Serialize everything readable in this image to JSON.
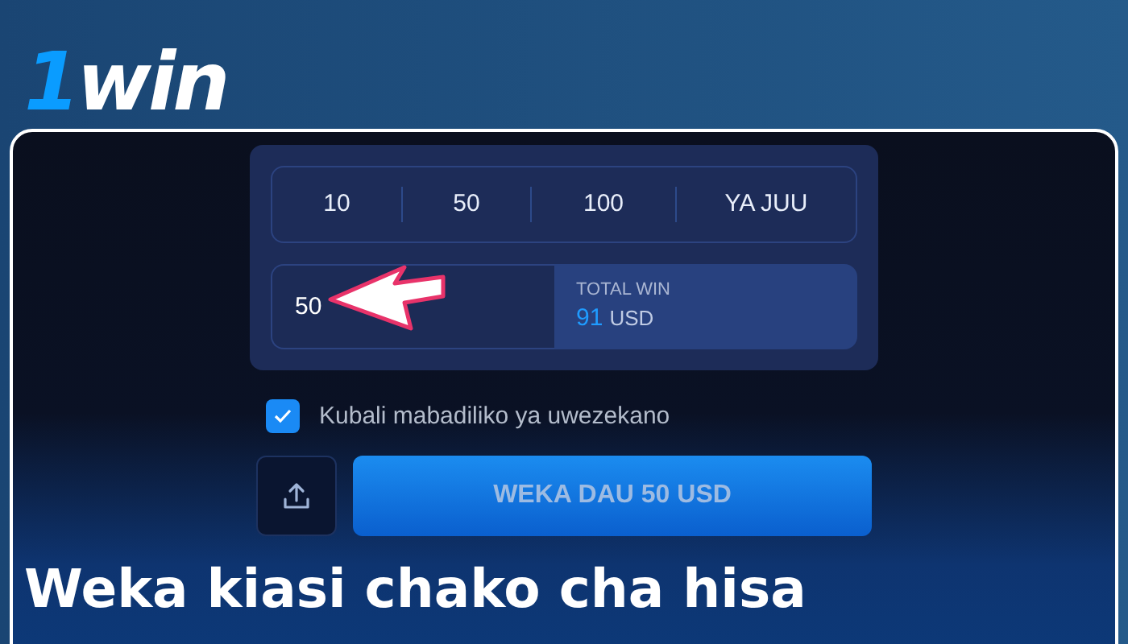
{
  "logo": {
    "mark": "1",
    "name": "win"
  },
  "quick_amounts": [
    "10",
    "50",
    "100",
    "YA JUU"
  ],
  "stake_input": {
    "value": "50"
  },
  "total_win": {
    "label": "TOTAL WIN",
    "amount": "91",
    "currency": "USD"
  },
  "accept_changes": {
    "label": "Kubali mabadiliko ya uwezekano",
    "checked": true
  },
  "place_bet_button": {
    "label": "WEKA DAU 50 USD"
  },
  "caption": "Weka kiasi chako cha hisa"
}
